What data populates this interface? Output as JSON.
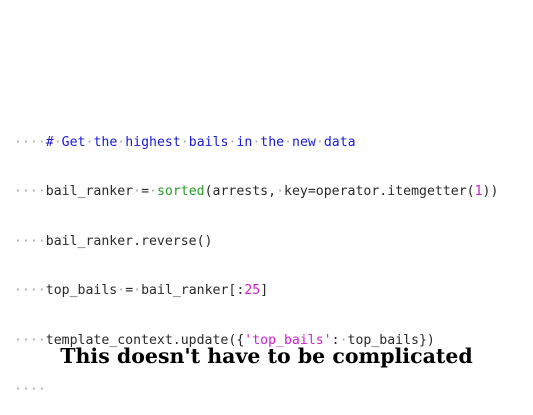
{
  "code": {
    "lines": [
      [
        {
          "t": "····",
          "k": "ws"
        },
        {
          "t": "#",
          "k": "comment"
        },
        {
          "t": "·",
          "k": "ws"
        },
        {
          "t": "Get",
          "k": "comment"
        },
        {
          "t": "·",
          "k": "ws"
        },
        {
          "t": "the",
          "k": "comment"
        },
        {
          "t": "·",
          "k": "ws"
        },
        {
          "t": "highest",
          "k": "comment"
        },
        {
          "t": "·",
          "k": "ws"
        },
        {
          "t": "bails",
          "k": "comment"
        },
        {
          "t": "·",
          "k": "ws"
        },
        {
          "t": "in",
          "k": "comment"
        },
        {
          "t": "·",
          "k": "ws"
        },
        {
          "t": "the",
          "k": "comment"
        },
        {
          "t": "·",
          "k": "ws"
        },
        {
          "t": "new",
          "k": "comment"
        },
        {
          "t": "·",
          "k": "ws"
        },
        {
          "t": "data",
          "k": "comment"
        }
      ],
      [
        {
          "t": "····",
          "k": "ws"
        },
        {
          "t": "bail_ranker",
          "k": "plain"
        },
        {
          "t": "·",
          "k": "ws"
        },
        {
          "t": "=",
          "k": "plain"
        },
        {
          "t": "·",
          "k": "ws"
        },
        {
          "t": "sorted",
          "k": "builtin"
        },
        {
          "t": "(arrests,",
          "k": "plain"
        },
        {
          "t": "·",
          "k": "ws"
        },
        {
          "t": "key=operator.itemgetter(",
          "k": "plain"
        },
        {
          "t": "1",
          "k": "number"
        },
        {
          "t": "))",
          "k": "plain"
        }
      ],
      [
        {
          "t": "····",
          "k": "ws"
        },
        {
          "t": "bail_ranker.reverse()",
          "k": "plain"
        }
      ],
      [
        {
          "t": "····",
          "k": "ws"
        },
        {
          "t": "top_bails",
          "k": "plain"
        },
        {
          "t": "·",
          "k": "ws"
        },
        {
          "t": "=",
          "k": "plain"
        },
        {
          "t": "·",
          "k": "ws"
        },
        {
          "t": "bail_ranker[:",
          "k": "plain"
        },
        {
          "t": "25",
          "k": "number"
        },
        {
          "t": "]",
          "k": "plain"
        }
      ],
      [
        {
          "t": "····",
          "k": "ws"
        },
        {
          "t": "template_context.update({",
          "k": "plain"
        },
        {
          "t": "'top_bails'",
          "k": "string"
        },
        {
          "t": ":",
          "k": "plain"
        },
        {
          "t": "·",
          "k": "ws"
        },
        {
          "t": "top_bails})",
          "k": "plain"
        }
      ],
      [
        {
          "t": "····",
          "k": "ws"
        }
      ]
    ]
  },
  "caption": "This doesn't have to be complicated"
}
